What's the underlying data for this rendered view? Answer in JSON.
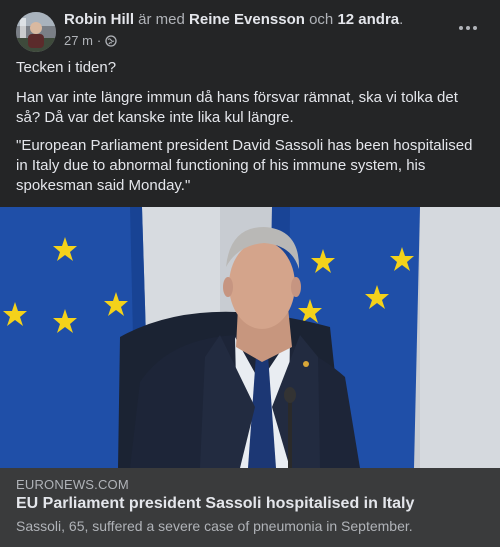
{
  "post": {
    "author": "Robin Hill",
    "with_text": " är med ",
    "tagged": "Reine Evensson",
    "and_text": " och ",
    "others": "12 andra",
    "period": ".",
    "time": "27 m",
    "separator": "·",
    "privacy_icon": "globe-icon",
    "more_icon": "more-options-icon",
    "text_line1": "Tecken i tiden?",
    "text_line2": "Han var inte längre immun då hans försvar rämnat, ska vi tolka det så? Då var det kanske inte lika kul längre.",
    "text_line3": "\"European Parliament president David Sassoli has been hospitalised in Italy due to abnormal functioning of his immune system, his spokesman said Monday.\""
  },
  "link": {
    "domain": "EURONEWS.COM",
    "title": "EU Parliament president Sassoli hospitalised in Italy",
    "description": "Sassoli, 65, suffered a severe case of pneumonia in September."
  },
  "colors": {
    "background": "#242526",
    "footer": "#3a3b3c",
    "eu_blue": "#1f4fa8",
    "eu_star": "#f4d21a"
  }
}
